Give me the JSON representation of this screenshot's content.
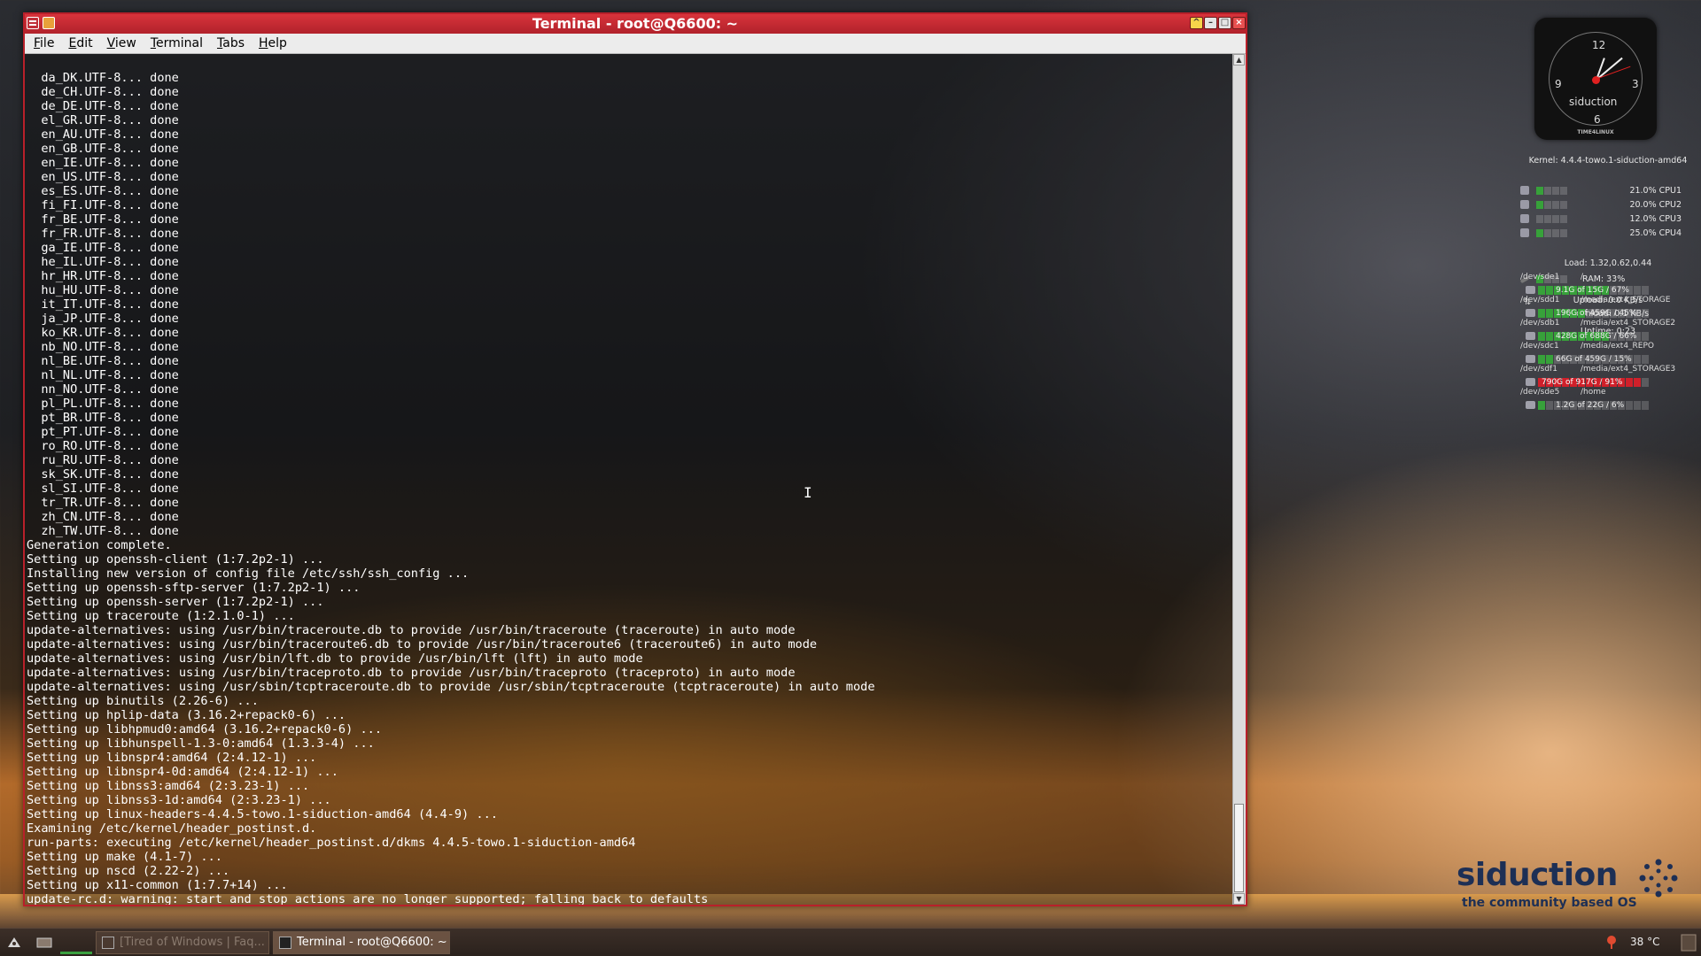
{
  "window": {
    "title": "Terminal - root@Q6600: ~"
  },
  "menu": {
    "items": [
      "File",
      "Edit",
      "View",
      "Terminal",
      "Tabs",
      "Help"
    ]
  },
  "terminal": {
    "lines": [
      "  da_DK.UTF-8... done",
      "  de_CH.UTF-8... done",
      "  de_DE.UTF-8... done",
      "  el_GR.UTF-8... done",
      "  en_AU.UTF-8... done",
      "  en_GB.UTF-8... done",
      "  en_IE.UTF-8... done",
      "  en_US.UTF-8... done",
      "  es_ES.UTF-8... done",
      "  fi_FI.UTF-8... done",
      "  fr_BE.UTF-8... done",
      "  fr_FR.UTF-8... done",
      "  ga_IE.UTF-8... done",
      "  he_IL.UTF-8... done",
      "  hr_HR.UTF-8... done",
      "  hu_HU.UTF-8... done",
      "  it_IT.UTF-8... done",
      "  ja_JP.UTF-8... done",
      "  ko_KR.UTF-8... done",
      "  nb_NO.UTF-8... done",
      "  nl_BE.UTF-8... done",
      "  nl_NL.UTF-8... done",
      "  nn_NO.UTF-8... done",
      "  pl_PL.UTF-8... done",
      "  pt_BR.UTF-8... done",
      "  pt_PT.UTF-8... done",
      "  ro_RO.UTF-8... done",
      "  ru_RU.UTF-8... done",
      "  sk_SK.UTF-8... done",
      "  sl_SI.UTF-8... done",
      "  tr_TR.UTF-8... done",
      "  zh_CN.UTF-8... done",
      "  zh_TW.UTF-8... done",
      "Generation complete.",
      "Setting up openssh-client (1:7.2p2-1) ...",
      "Installing new version of config file /etc/ssh/ssh_config ...",
      "Setting up openssh-sftp-server (1:7.2p2-1) ...",
      "Setting up openssh-server (1:7.2p2-1) ...",
      "Setting up traceroute (1:2.1.0-1) ...",
      "update-alternatives: using /usr/bin/traceroute.db to provide /usr/bin/traceroute (traceroute) in auto mode",
      "update-alternatives: using /usr/bin/traceroute6.db to provide /usr/bin/traceroute6 (traceroute6) in auto mode",
      "update-alternatives: using /usr/bin/lft.db to provide /usr/bin/lft (lft) in auto mode",
      "update-alternatives: using /usr/bin/traceproto.db to provide /usr/bin/traceproto (traceproto) in auto mode",
      "update-alternatives: using /usr/sbin/tcptraceroute.db to provide /usr/sbin/tcptraceroute (tcptraceroute) in auto mode",
      "Setting up binutils (2.26-6) ...",
      "Setting up hplip-data (3.16.2+repack0-6) ...",
      "Setting up libhpmud0:amd64 (3.16.2+repack0-6) ...",
      "Setting up libhunspell-1.3-0:amd64 (1.3.3-4) ...",
      "Setting up libnspr4:amd64 (2:4.12-1) ...",
      "Setting up libnspr4-0d:amd64 (2:4.12-1) ...",
      "Setting up libnss3:amd64 (2:3.23-1) ...",
      "Setting up libnss3-1d:amd64 (2:3.23-1) ...",
      "Setting up linux-headers-4.4.5-towo.1-siduction-amd64 (4.4-9) ...",
      "Examining /etc/kernel/header_postinst.d.",
      "run-parts: executing /etc/kernel/header_postinst.d/dkms 4.4.5-towo.1-siduction-amd64",
      "Setting up make (4.1-7) ...",
      "Setting up nscd (2.22-2) ...",
      "Setting up x11-common (1:7.7+14) ...",
      "update-rc.d: warning: start and stop actions are no longer supported; falling back to defaults"
    ]
  },
  "conky": {
    "clock": {
      "n12": "12",
      "n3": "3",
      "n6": "6",
      "n9": "9",
      "brand": "siduction",
      "footer": "TIME4LINUX"
    },
    "kernel": "Kernel: 4.4.4-towo.1-siduction-amd64",
    "cpus": [
      {
        "label": "21.0% CPU1",
        "level": 0.21
      },
      {
        "label": "20.0% CPU2",
        "level": 0.2
      },
      {
        "label": "12.0% CPU3",
        "level": 0.12
      },
      {
        "label": "25.0% CPU4",
        "level": 0.25
      }
    ],
    "load": "Load: 1.32,0.62,0.44",
    "ram": {
      "label": "RAM: 33%",
      "level": 0.33
    },
    "upload": "Upload: 0.0 KB/s",
    "download": "Download: 0.1 KB/s",
    "uptime": "Uptime: 0:23",
    "disks": [
      {
        "dev": "/dev/sde1",
        "mount": "/",
        "usage": "9.1G of 15G / 67%",
        "level": 0.67,
        "hot": false
      },
      {
        "dev": "/dev/sdd1",
        "mount": "/media/ext4_STORAGE",
        "usage": "196G of 459G / 45%",
        "level": 0.45,
        "hot": false
      },
      {
        "dev": "/dev/sdb1",
        "mount": "/media/ext4_STORAGE2",
        "usage": "428G of 688G / 66%",
        "level": 0.66,
        "hot": false
      },
      {
        "dev": "/dev/sdc1",
        "mount": "/media/ext4_REPO",
        "usage": "66G of 459G / 15%",
        "level": 0.15,
        "hot": false
      },
      {
        "dev": "/dev/sdf1",
        "mount": "/media/ext4_STORAGE3",
        "usage": "790G of 917G / 91%",
        "level": 0.91,
        "hot": true
      },
      {
        "dev": "/dev/sde5",
        "mount": "/home",
        "usage": "1.2G of 22G / 6%",
        "level": 0.06,
        "hot": false
      }
    ]
  },
  "logo": {
    "word": "siduction",
    "tagline": "the community based OS"
  },
  "taskbar": {
    "tasks": [
      {
        "label": "[Tired of Windows | Faq...",
        "active": false
      },
      {
        "label": "Terminal - root@Q6600: ~",
        "active": true
      }
    ],
    "temperature": "38 °C"
  },
  "icons": {
    "window_menu": "window-menu-icon",
    "sticky": "sticky-icon",
    "start": "start-menu-icon",
    "show_desktop": "show-desktop-icon",
    "temperature": "thermometer-icon"
  },
  "colors": {
    "titlebar": "#c42a32",
    "accent_green": "#37a13a",
    "disk_hot": "#d0202a",
    "logo": "#1d2f55"
  }
}
